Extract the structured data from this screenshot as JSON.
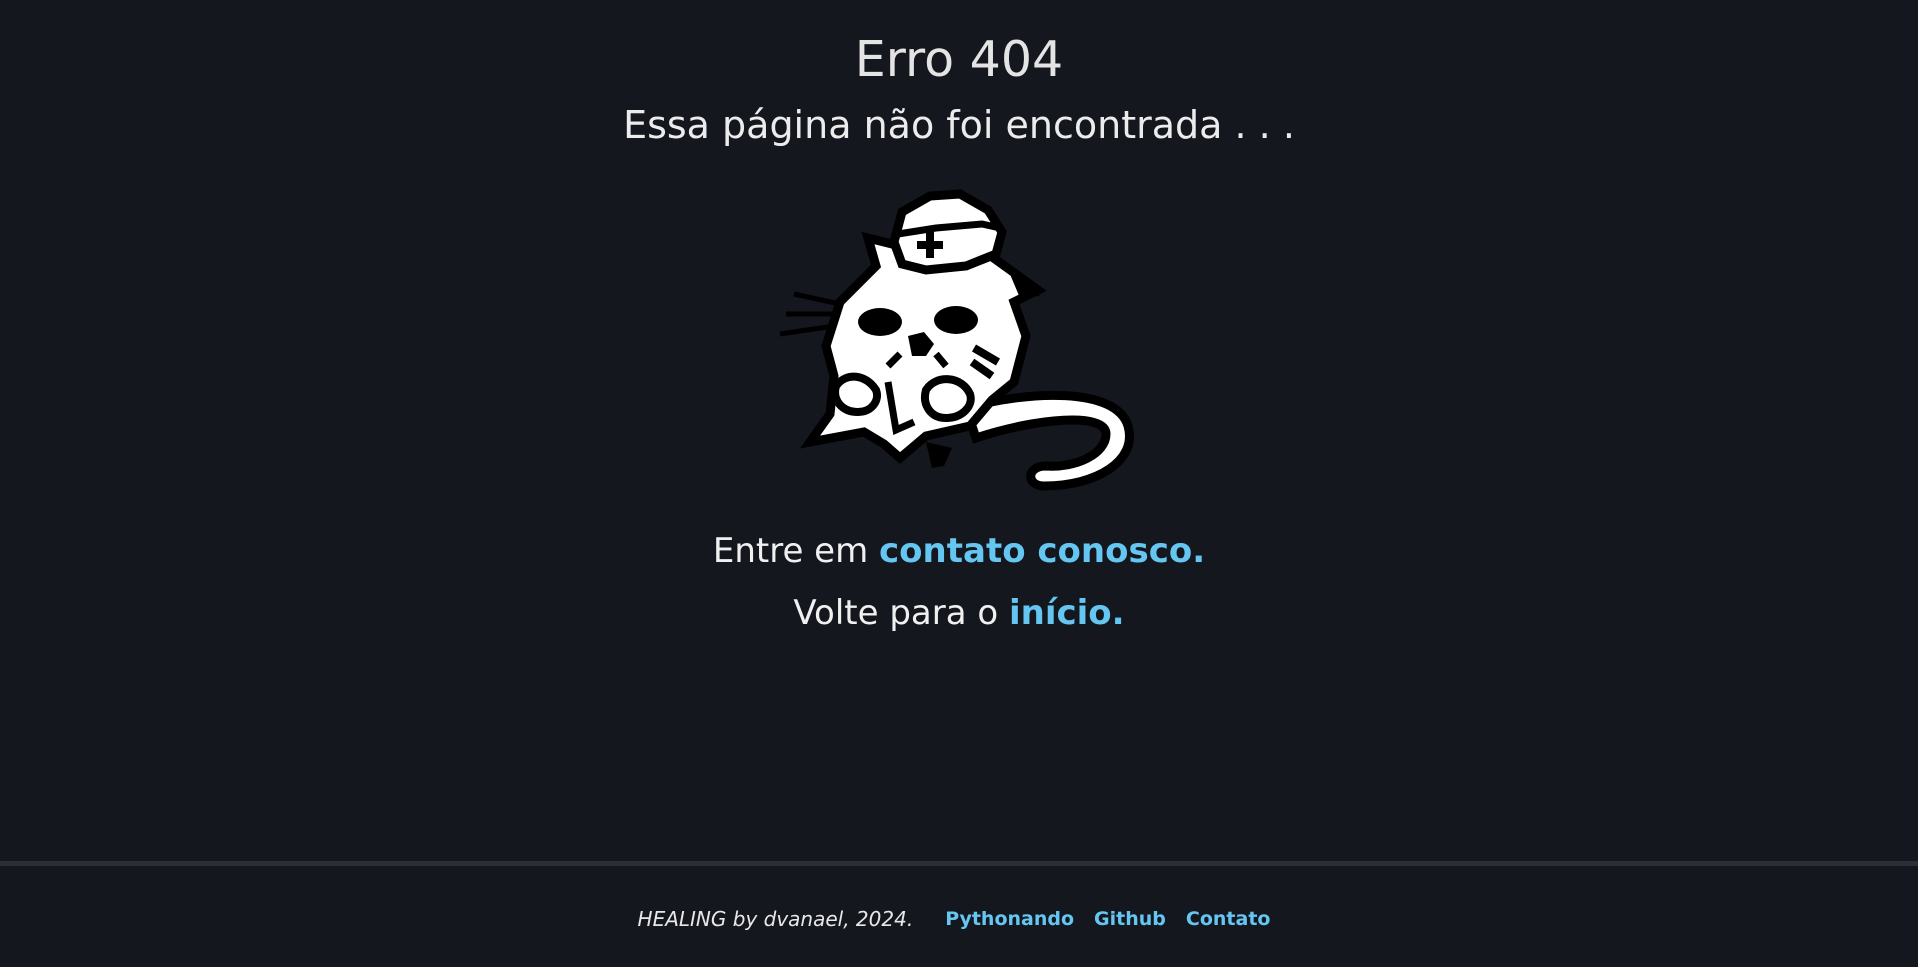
{
  "header": {
    "title": "Erro 404",
    "subtitle": "Essa página não foi encontrada . . ."
  },
  "illustration": {
    "icon": "cat-nurse-pixel-icon"
  },
  "message": {
    "contact_prefix": "Entre em ",
    "contact_link": "contato conosco.",
    "home_prefix": "Volte para o ",
    "home_link": "início."
  },
  "footer": {
    "credit": "HEALING by dvanael, 2024.",
    "links": [
      "Pythonando",
      "Github",
      "Contato"
    ]
  },
  "colors": {
    "background": "#14171e",
    "text": "#e6e6e6",
    "link": "#66c6f2",
    "divider": "#2a3038"
  }
}
